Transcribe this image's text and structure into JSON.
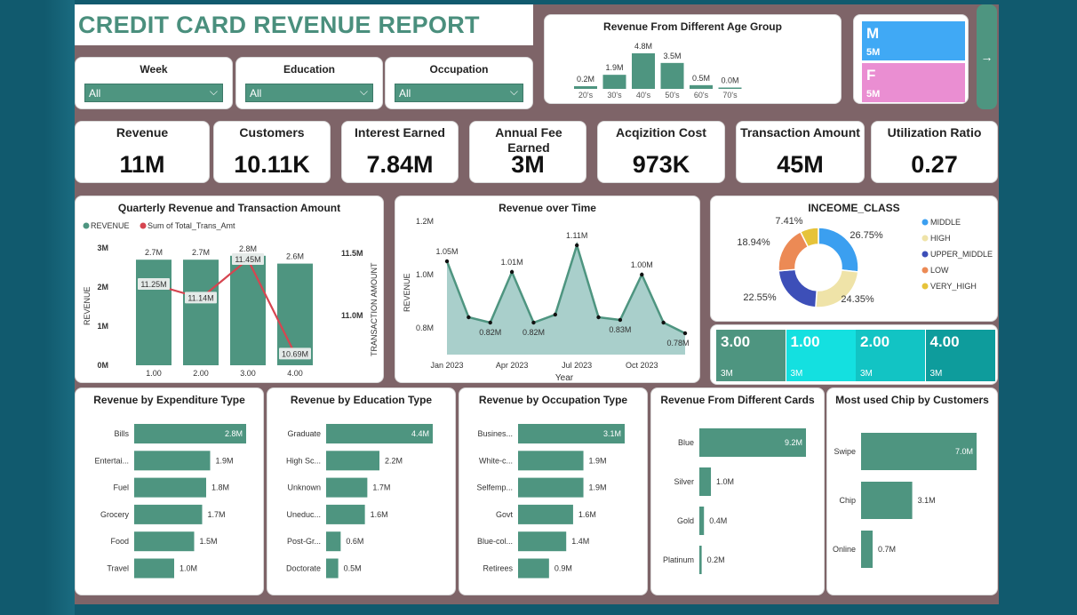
{
  "title": "CREDIT CARD REVENUE REPORT",
  "slicers": [
    {
      "label": "Week",
      "value": "All"
    },
    {
      "label": "Education",
      "value": "All"
    },
    {
      "label": "Occupation",
      "value": "All"
    }
  ],
  "kpis": [
    {
      "label": "Revenue",
      "value": "11M"
    },
    {
      "label": "Customers",
      "value": "10.11K"
    },
    {
      "label": "Interest Earned",
      "value": "7.84M"
    },
    {
      "label": "Annual Fee Earned",
      "value": "3M"
    },
    {
      "label": "Acqizition Cost",
      "value": "973K"
    },
    {
      "label": "Transaction Amount",
      "value": "45M"
    },
    {
      "label": "Utilization Ratio",
      "value": "0.27"
    }
  ],
  "gender": [
    {
      "label": "M",
      "value": "5M",
      "color": "#40a9f5"
    },
    {
      "label": "F",
      "value": "5M",
      "color": "#ea8ed2"
    }
  ],
  "nav_arrow": "→",
  "grid_tiles": [
    {
      "value": "3.00",
      "sub": "3M",
      "color": "#4e9580"
    },
    {
      "value": "1.00",
      "sub": "3M",
      "color": "#14e0e0"
    },
    {
      "value": "2.00",
      "sub": "3M",
      "color": "#12c4c4"
    },
    {
      "value": "4.00",
      "sub": "3M",
      "color": "#0e9c9c"
    }
  ],
  "colors": {
    "teal": "#4e9580",
    "red": "#d64550",
    "area": "#a9cfcb"
  },
  "chart_data": [
    {
      "id": "age",
      "type": "bar",
      "title": "Revenue From Different Age Group",
      "categories": [
        "20's",
        "30's",
        "40's",
        "50's",
        "60's",
        "70's"
      ],
      "values": [
        0.2,
        1.9,
        4.8,
        3.5,
        0.5,
        0.0
      ],
      "labels": [
        "0.2M",
        "1.9M",
        "4.8M",
        "3.5M",
        "0.5M",
        "0.0M"
      ]
    },
    {
      "id": "quarterly",
      "type": "bar",
      "title": "Quarterly Revenue and Transaction Amount",
      "legend": [
        "REVENUE",
        "Sum of Total_Trans_Amt"
      ],
      "categories": [
        "1.00",
        "2.00",
        "3.00",
        "4.00"
      ],
      "series": [
        {
          "name": "REVENUE",
          "values": [
            2.7,
            2.7,
            2.8,
            2.6
          ],
          "labels": [
            "2.7M",
            "2.7M",
            "2.8M",
            "2.6M"
          ]
        },
        {
          "name": "Sum of Total_Trans_Amt",
          "values": [
            11.25,
            11.14,
            11.45,
            10.69
          ],
          "labels": [
            "11.25M",
            "11.14M",
            "11.45M",
            "10.69M"
          ]
        }
      ],
      "ylabel": "REVENUE",
      "y2label": "TRANSACTION AMOUNT",
      "yticks": [
        "3M",
        "2M",
        "1M",
        "0M"
      ],
      "y2ticks": [
        "11.5M",
        "11.0M"
      ]
    },
    {
      "id": "time",
      "type": "area",
      "title": "Revenue over Time",
      "xlabel": "Year",
      "ylabel": "REVENUE",
      "xticks": [
        "Jan 2023",
        "Apr 2023",
        "Jul 2023",
        "Oct 2023"
      ],
      "yticks": [
        "1.2M",
        "1.0M",
        "0.8M"
      ],
      "values": [
        1.05,
        0.84,
        0.82,
        1.01,
        0.82,
        0.85,
        1.11,
        0.84,
        0.83,
        1.0,
        0.82,
        0.78
      ],
      "point_labels": {
        "0": "1.05M",
        "2": "0.82M",
        "3": "1.01M",
        "4": "0.82M",
        "6": "1.11M",
        "8": "0.83M",
        "9": "1.00M",
        "11": "0.78M"
      }
    },
    {
      "id": "income",
      "type": "pie",
      "title": "INCEOME_CLASS",
      "slices": [
        {
          "name": "MIDDLE",
          "value": 26.75,
          "label": "26.75%",
          "color": "#3b9ff0"
        },
        {
          "name": "HIGH",
          "value": 24.35,
          "label": "24.35%",
          "color": "#efe3a8"
        },
        {
          "name": "UPPER_MIDDLE",
          "value": 22.55,
          "label": "22.55%",
          "color": "#3d4fb8"
        },
        {
          "name": "LOW",
          "value": 18.94,
          "label": "18.94%",
          "color": "#ec8a55"
        },
        {
          "name": "VERY_HIGH",
          "value": 7.41,
          "label": "7.41%",
          "color": "#e6c33a"
        }
      ]
    },
    {
      "id": "expenditure",
      "type": "bar",
      "title": "Revenue by Expenditure Type",
      "categories": [
        "Bills",
        "Entertai...",
        "Fuel",
        "Grocery",
        "Food",
        "Travel"
      ],
      "values": [
        2.8,
        1.9,
        1.8,
        1.7,
        1.5,
        1.0
      ],
      "labels": [
        "2.8M",
        "1.9M",
        "1.8M",
        "1.7M",
        "1.5M",
        "1.0M"
      ]
    },
    {
      "id": "education",
      "type": "bar",
      "title": "Revenue by Education Type",
      "categories": [
        "Graduate",
        "High Sc...",
        "Unknown",
        "Uneduc...",
        "Post-Gr...",
        "Doctorate"
      ],
      "values": [
        4.4,
        2.2,
        1.7,
        1.6,
        0.6,
        0.5
      ],
      "labels": [
        "4.4M",
        "2.2M",
        "1.7M",
        "1.6M",
        "0.6M",
        "0.5M"
      ]
    },
    {
      "id": "occupation",
      "type": "bar",
      "title": "Revenue by Occupation Type",
      "categories": [
        "Busines...",
        "White-c...",
        "Selfemp...",
        "Govt",
        "Blue-col...",
        "Retirees"
      ],
      "values": [
        3.1,
        1.9,
        1.9,
        1.6,
        1.4,
        0.9
      ],
      "labels": [
        "3.1M",
        "1.9M",
        "1.9M",
        "1.6M",
        "1.4M",
        "0.9M"
      ]
    },
    {
      "id": "cards",
      "type": "bar",
      "title": "Revenue From Different Cards",
      "categories": [
        "Blue",
        "Silver",
        "Gold",
        "Platinum"
      ],
      "values": [
        9.2,
        1.0,
        0.4,
        0.2
      ],
      "labels": [
        "9.2M",
        "1.0M",
        "0.4M",
        "0.2M"
      ]
    },
    {
      "id": "chip",
      "type": "bar",
      "title": "Most used Chip by Customers",
      "categories": [
        "Swipe",
        "Chip",
        "Online"
      ],
      "values": [
        7.0,
        3.1,
        0.7
      ],
      "labels": [
        "7.0M",
        "3.1M",
        "0.7M"
      ]
    }
  ]
}
